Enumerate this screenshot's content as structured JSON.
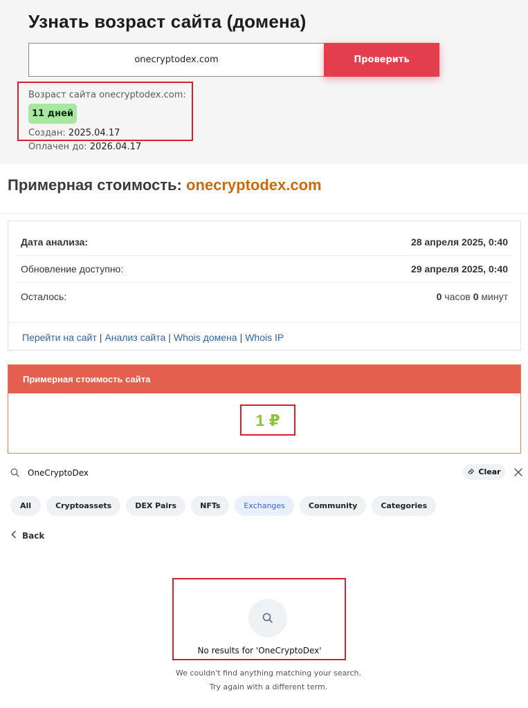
{
  "age_checker": {
    "title": "Узнать возраст сайта (домена)",
    "input_value": "onecryptodex.com",
    "button_label": "Проверить",
    "result_label": "Возраст сайта onecryptodex.com:",
    "age_badge": "11 дней",
    "created_label": "Создан:",
    "created_value": "2025.04.17",
    "paid_label": "Оплачен до:",
    "paid_value": "2026.04.17"
  },
  "cost": {
    "title_prefix": "Примерная стоимость:",
    "title_domain": "onecryptodex.com",
    "rows": [
      {
        "label": "Дата анализа:",
        "value": "28 апреля 2025, 0:40"
      },
      {
        "label": "Обновление доступно:",
        "value": "29 апреля 2025, 0:40"
      },
      {
        "label": "Осталось:",
        "hours": "0",
        "hours_unit": "часов",
        "minutes": "0",
        "minutes_unit": "минут"
      }
    ],
    "links": [
      "Перейти на сайт",
      "Анализ сайта",
      "Whois домена",
      "Whois IP"
    ],
    "separator": "|",
    "value_header": "Примерная стоимость сайта",
    "value_amount": "1 ₽",
    "colors": {
      "header": "#e3604f",
      "amount": "#8cc63f",
      "domain": "#c86a12",
      "links": "#2f63a8",
      "button": "#e23e4e",
      "badge": "#a9e6a1",
      "highlight": "#d0222e"
    }
  },
  "search": {
    "query": "OneCryptoDex",
    "clear_label": "Clear",
    "filters": [
      "All",
      "Cryptoassets",
      "DEX Pairs",
      "NFTs",
      "Exchanges",
      "Community",
      "Categories"
    ],
    "active_filter": "Exchanges",
    "back_label": "Back",
    "empty_title": "No results for 'OneCryptoDex'",
    "empty_line1": "We couldn't find anything matching your search.",
    "empty_line2": "Try again with a different term."
  }
}
